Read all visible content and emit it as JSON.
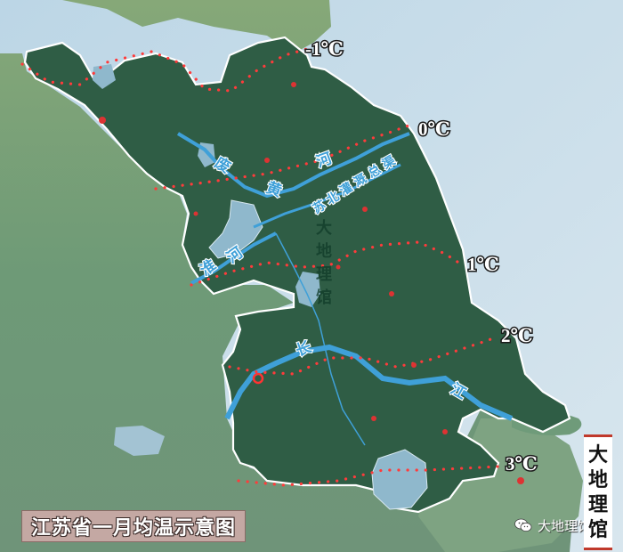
{
  "map": {
    "title": "江苏省一月均温示意图",
    "isotherms": [
      {
        "label": "-1℃",
        "value": -1
      },
      {
        "label": "0℃",
        "value": 0
      },
      {
        "label": "1℃",
        "value": 1
      },
      {
        "label": "2℃",
        "value": 2
      },
      {
        "label": "3℃",
        "value": 3
      }
    ],
    "rivers": [
      {
        "name": "废黄河",
        "chars": [
          "废",
          "黄",
          "河"
        ]
      },
      {
        "name": "苏北灌溉总渠",
        "chars": [
          "苏",
          "北",
          "灌",
          "溉",
          "总",
          "渠"
        ]
      },
      {
        "name": "淮河",
        "chars": [
          "淮",
          "河"
        ]
      },
      {
        "name": "长江",
        "chars": [
          "长",
          "江"
        ]
      }
    ],
    "watermark_vertical": [
      "大",
      "地",
      "理",
      "馆"
    ],
    "brand_vertical": [
      "大",
      "地",
      "理",
      "馆"
    ],
    "wechat_label": "大地理馆",
    "colors": {
      "province": "#2f5d45",
      "isotherm_dots": "#e23b3b",
      "river": "#3fa0d8",
      "sea": "#a9c9dc",
      "outside": "#6f9878"
    },
    "icons": [
      "wechat-icon"
    ]
  }
}
